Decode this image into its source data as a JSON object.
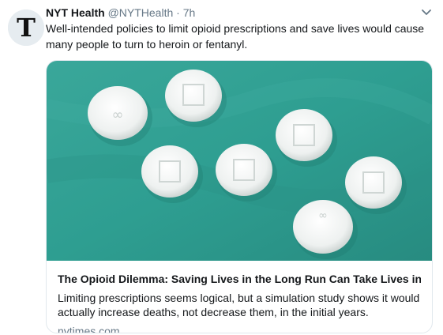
{
  "tweet": {
    "author_name": "NYT Health",
    "author_handle": "@NYTHealth",
    "separator": "·",
    "time": "7h",
    "text": "Well-intended policies to limit opioid prescriptions and save lives would cause many people to turn to heroin or fentanyl."
  },
  "card": {
    "title": "The Opioid Dilemma: Saving Lives in the Long Run Can Take Lives in...",
    "description": "Limiting prescriptions seems logical, but a simulation study shows it would actually increase deaths, not decrease them, in the initial years.",
    "domain": "nytimes.com",
    "image_description_icon": "pills-photo"
  },
  "colors": {
    "text_primary": "#14171a",
    "text_secondary": "#657786",
    "border": "#e1e8ed",
    "photo_background": "#2e9e91"
  }
}
